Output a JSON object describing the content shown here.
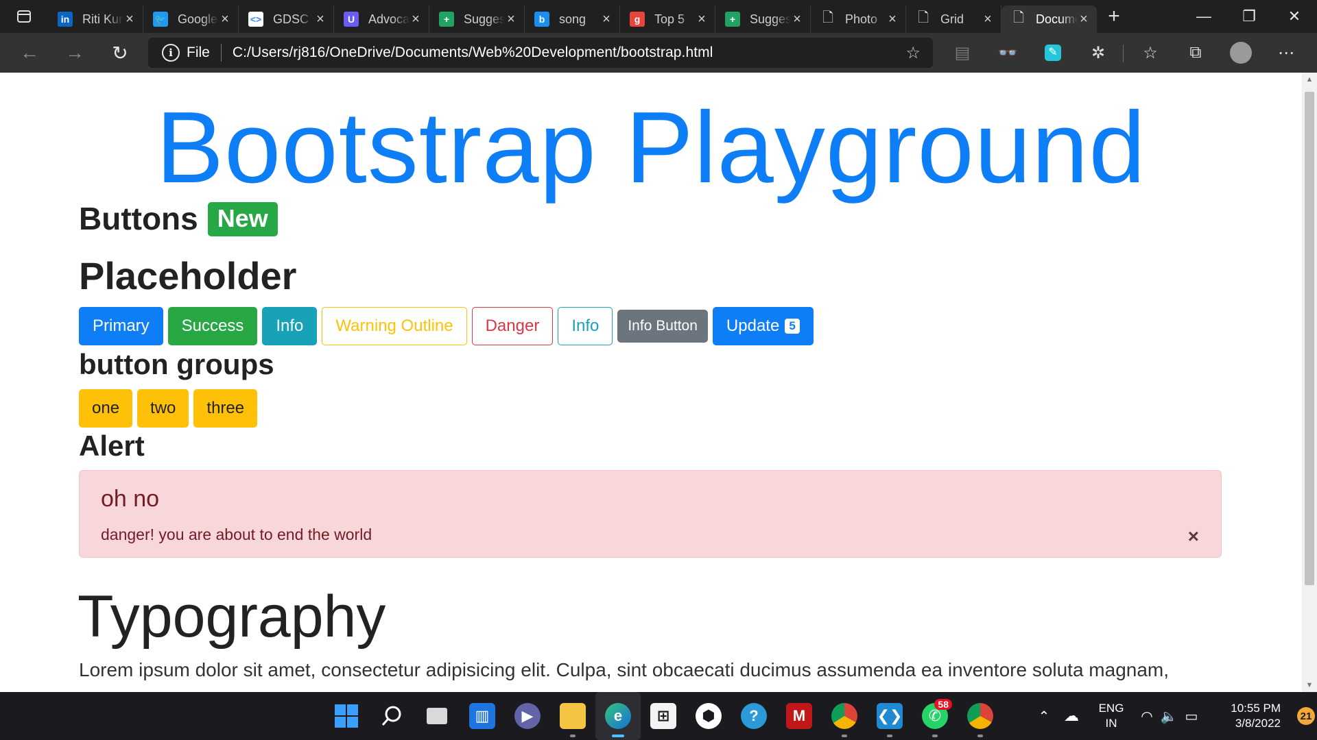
{
  "browser": {
    "tabs": [
      {
        "title": "Riti Kumari",
        "favicon": "linkedin-icon",
        "color": "#0a66c2",
        "glyph": "in"
      },
      {
        "title": "Google",
        "favicon": "twitter-icon",
        "color": "#1d9bf0",
        "glyph": "🐦"
      },
      {
        "title": "GDSC",
        "favicon": "gdsc-icon",
        "color": "#ffffff",
        "glyph": "<>"
      },
      {
        "title": "Advocate",
        "favicon": "u-icon",
        "color": "#6b5bf5",
        "glyph": "U"
      },
      {
        "title": "Suggestions",
        "favicon": "plus-icon",
        "color": "#21a366",
        "glyph": "+"
      },
      {
        "title": "song",
        "favicon": "bing-icon",
        "color": "#1b8ef2",
        "glyph": "b"
      },
      {
        "title": "Top 5",
        "favicon": "g-icon",
        "color": "#e8453c",
        "glyph": "g"
      },
      {
        "title": "Suggestions",
        "favicon": "plus-icon",
        "color": "#21a366",
        "glyph": "+"
      },
      {
        "title": "Photo",
        "favicon": "page-icon",
        "color": "none",
        "glyph": "🗋"
      },
      {
        "title": "Grid",
        "favicon": "page-icon",
        "color": "none",
        "glyph": "🗋"
      },
      {
        "title": "Document",
        "favicon": "page-icon",
        "color": "none",
        "glyph": "🗋"
      }
    ],
    "address": {
      "scheme": "File",
      "url": "C:/Users/rj816/OneDrive/Documents/Web%20Development/bootstrap.html"
    }
  },
  "page": {
    "title": "Bootstrap Playground",
    "buttons_heading": "Buttons",
    "new_badge": "New",
    "placeholder_heading": "Placeholder",
    "buttons": {
      "primary": "Primary",
      "success": "Success",
      "info": "Info",
      "warning_outline": "Warning Outline",
      "danger": "Danger",
      "info_outline": "Info",
      "info_button": "Info Button",
      "update": "Update",
      "update_count": "5"
    },
    "button_groups_heading": "button groups",
    "group_buttons": [
      "one",
      "two",
      "three"
    ],
    "alert_heading": "Alert",
    "alert": {
      "title": "oh no",
      "message": "danger! you are about to end the world",
      "close": "×"
    },
    "typography_heading": "Typography",
    "lorem": "Lorem ipsum dolor sit amet, consectetur adipisicing elit. Culpa, sint obcaecati ducimus assumenda ea inventore soluta magnam,"
  },
  "colors": {
    "primary": "#0d7ef5",
    "success": "#28a745",
    "info": "#17a2b8",
    "warning": "#ffc107",
    "danger": "#dc3545",
    "secondary": "#6c757d"
  },
  "taskbar": {
    "weather_badge": "58",
    "lang_line1": "ENG",
    "lang_line2": "IN",
    "time": "10:55 PM",
    "date": "3/8/2022",
    "notifications": "21"
  }
}
